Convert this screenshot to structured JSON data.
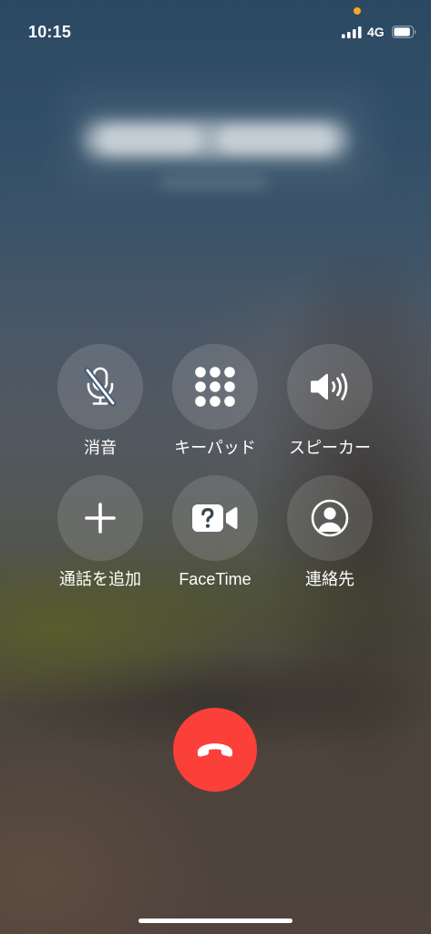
{
  "status_bar": {
    "time": "10:15",
    "network": "4G",
    "signal_bars": 4,
    "signal_bars_max": 4,
    "battery_level": 0.9,
    "privacy_indicator_color": "#f5a623"
  },
  "call_controls": [
    {
      "label": "消音",
      "icon": "mic-slash-icon"
    },
    {
      "label": "キーパッド",
      "icon": "keypad-icon"
    },
    {
      "label": "スピーカー",
      "icon": "speaker-wave-icon"
    },
    {
      "label": "通話を追加",
      "icon": "plus-icon"
    },
    {
      "label": "FaceTime",
      "icon": "facetime-video-icon"
    },
    {
      "label": "連絡先",
      "icon": "contact-icon"
    }
  ],
  "end_call": {
    "icon": "phone-down-icon",
    "color": "#fb3f39"
  }
}
